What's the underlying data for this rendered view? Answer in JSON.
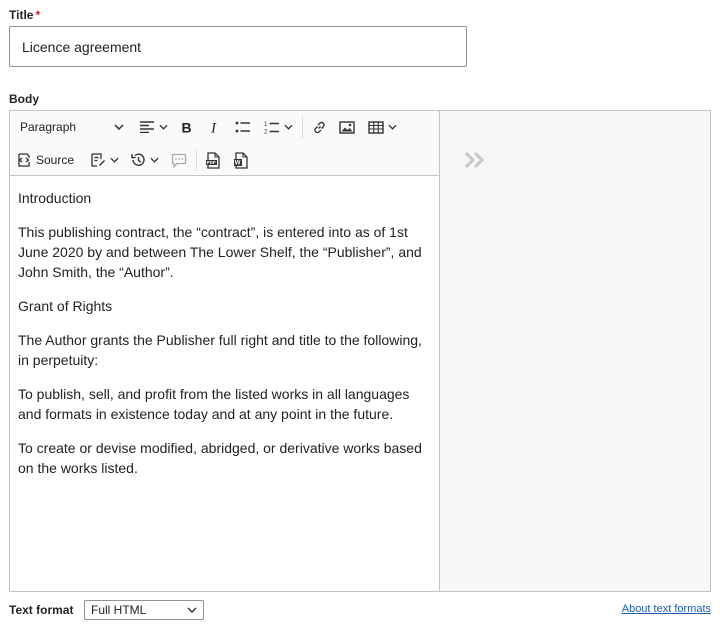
{
  "title_field": {
    "label": "Title",
    "required_marker": "*",
    "value": "Licence agreement"
  },
  "body_field": {
    "label": "Body",
    "toolbar": {
      "heading_select": "Paragraph",
      "source_label": "Source",
      "row1_icons": [
        "alignment-icon",
        "bold-icon",
        "italic-icon",
        "bulleted-list-icon",
        "numbered-list-icon",
        "link-icon",
        "image-icon",
        "table-icon"
      ],
      "row2_icons": [
        "source-icon",
        "style-icon",
        "history-icon",
        "comment-icon",
        "export-pdf-icon",
        "export-word-icon"
      ]
    },
    "content": {
      "paragraphs": [
        "Introduction",
        "This publishing contract, the “contract”, is entered into as of 1st June 2020 by and between The Lower Shelf, the “Publisher”, and John Smith, the “Author”.",
        "Grant of Rights",
        "The Author grants the Publisher full right and title to the following, in perpetuity:",
        "To publish, sell, and profit from the listed works in all languages and formats in existence today and at any point in the future.",
        "To create or devise modified, abridged, or derivative works based on the works listed."
      ]
    },
    "side_panel": {
      "toggle_icon": "double-chevron-right-icon"
    }
  },
  "text_format": {
    "label": "Text format",
    "selected": "Full HTML",
    "about_link": "About text formats"
  },
  "colors": {
    "required": "#d72222",
    "link": "#1a5fb4",
    "border": "#c4c4c4",
    "toolbar_bg": "#fafafa",
    "panel_bg": "#f7f7f7"
  }
}
